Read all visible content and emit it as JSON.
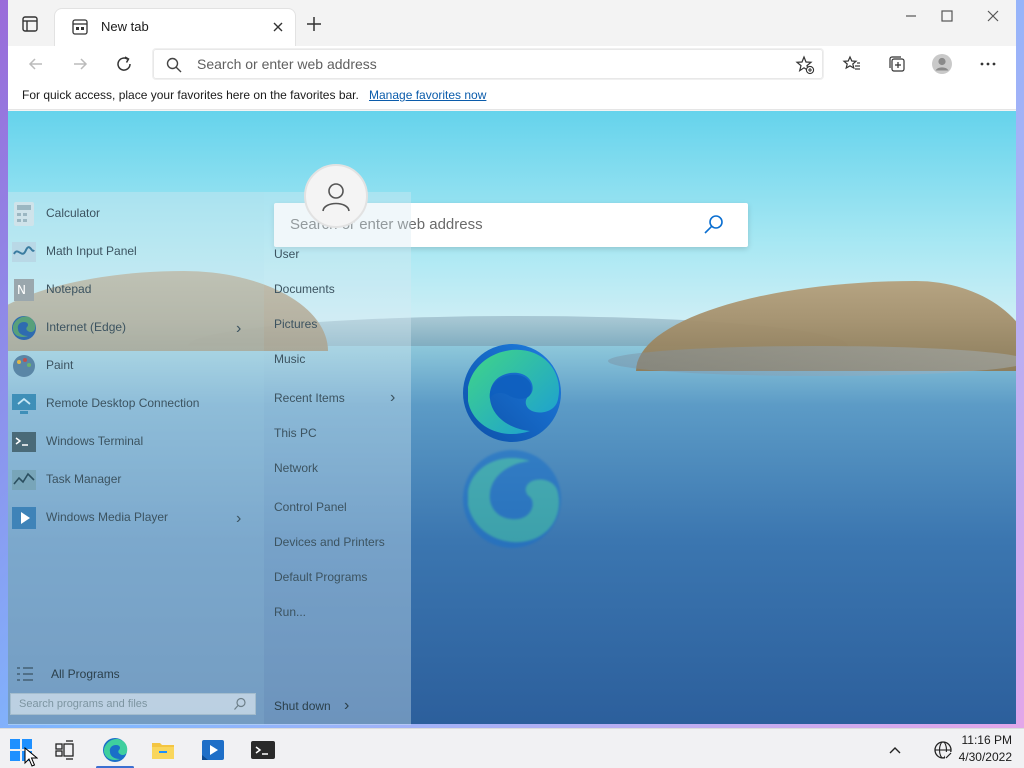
{
  "browser": {
    "tab_title": "New tab",
    "address_placeholder": "Search or enter web address",
    "favorites_message": "For quick access, place your favorites here on the favorites bar.",
    "favorites_link": "Manage favorites now"
  },
  "page": {
    "search_placeholder": "Search or enter web address"
  },
  "start_menu": {
    "programs": [
      {
        "label": "Calculator",
        "icon": "calculator-icon",
        "has_arrow": false
      },
      {
        "label": "Math Input Panel",
        "icon": "math-input-icon",
        "has_arrow": false
      },
      {
        "label": "Notepad",
        "icon": "notepad-icon",
        "has_arrow": false
      },
      {
        "label": "Internet (Edge)",
        "icon": "edge-icon",
        "has_arrow": true
      },
      {
        "label": "Paint",
        "icon": "paint-icon",
        "has_arrow": false
      },
      {
        "label": "Remote Desktop Connection",
        "icon": "remote-desktop-icon",
        "has_arrow": false
      },
      {
        "label": "Windows Terminal",
        "icon": "terminal-icon",
        "has_arrow": false
      },
      {
        "label": "Task Manager",
        "icon": "task-manager-icon",
        "has_arrow": false
      },
      {
        "label": "Windows Media Player",
        "icon": "media-player-icon",
        "has_arrow": true
      }
    ],
    "places": [
      {
        "label": "User",
        "has_arrow": false
      },
      {
        "label": "Documents",
        "has_arrow": false
      },
      {
        "label": "Pictures",
        "has_arrow": false
      },
      {
        "label": "Music",
        "has_arrow": false
      },
      {
        "label": "Recent Items",
        "has_arrow": true
      },
      {
        "label": "This PC",
        "has_arrow": false
      },
      {
        "label": "Network",
        "has_arrow": false
      },
      {
        "label": "Control Panel",
        "has_arrow": false
      },
      {
        "label": "Devices and Printers",
        "has_arrow": false
      },
      {
        "label": "Default Programs",
        "has_arrow": false
      },
      {
        "label": "Run...",
        "has_arrow": false
      }
    ],
    "all_programs": "All Programs",
    "search_placeholder": "Search programs and files",
    "shutdown": "Shut down"
  },
  "taskbar": {
    "time": "11:16 PM",
    "date": "4/30/2022"
  },
  "colors": {
    "accent": "#3b6fd1",
    "link": "#0b5cab"
  }
}
